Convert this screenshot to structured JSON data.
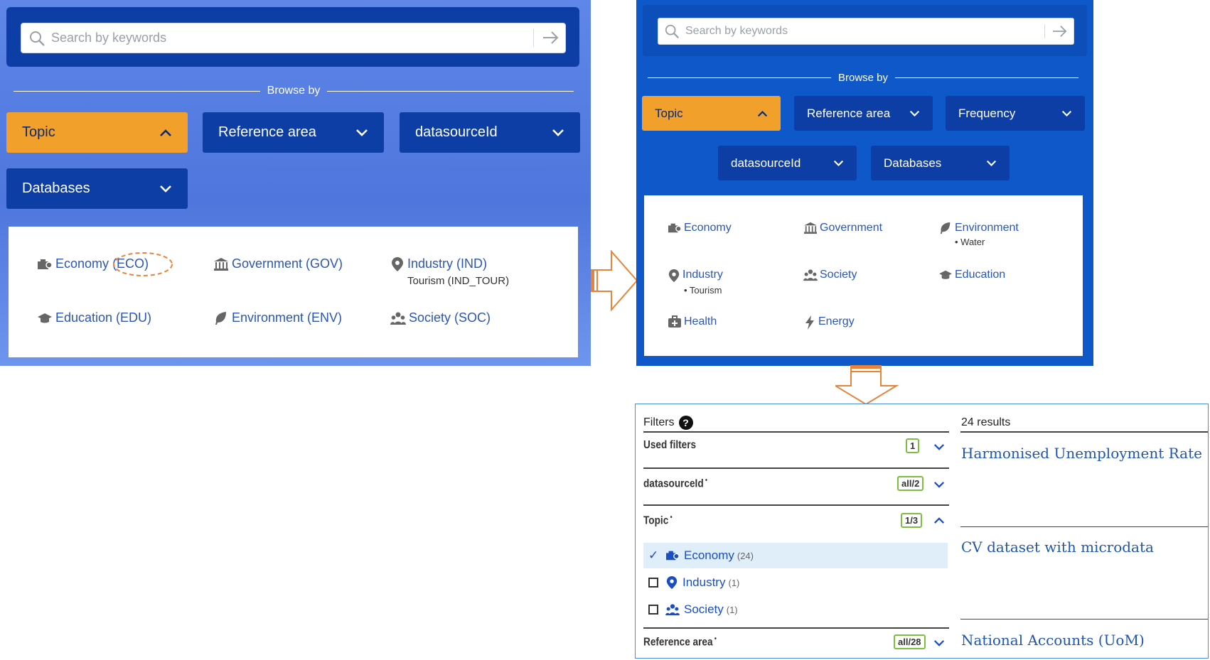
{
  "left_panel": {
    "search_placeholder": "Search by keywords",
    "browse_by": "Browse by",
    "buttons": [
      "Topic",
      "Reference area",
      "datasourceId",
      "Databases"
    ],
    "topics": [
      {
        "label": "Economy (ECO)",
        "icon": "economy-icon"
      },
      {
        "label": "Government (GOV)",
        "icon": "government-icon"
      },
      {
        "label": "Industry (IND)",
        "sub": "Tourism (IND_TOUR)",
        "icon": "location-pin-icon"
      },
      {
        "label": "Education (EDU)",
        "icon": "graduation-cap-icon"
      },
      {
        "label": "Environment (ENV)",
        "icon": "leaf-icon"
      },
      {
        "label": "Society (SOC)",
        "icon": "people-icon"
      }
    ]
  },
  "right_panel": {
    "search_placeholder": "Search by keywords",
    "browse_by": "Browse by",
    "buttons": [
      "Topic",
      "Reference area",
      "Frequency",
      "datasourceId",
      "Databases"
    ],
    "topics": [
      {
        "label": "Economy",
        "icon": "economy-icon"
      },
      {
        "label": "Government",
        "icon": "government-icon"
      },
      {
        "label": "Environment",
        "sub": "• Water",
        "icon": "leaf-icon"
      },
      {
        "label": "Industry",
        "sub": "• Tourism",
        "icon": "location-pin-icon"
      },
      {
        "label": "Society",
        "icon": "people-icon"
      },
      {
        "label": "Education",
        "icon": "graduation-cap-icon"
      },
      {
        "label": "Health",
        "icon": "medical-kit-icon"
      },
      {
        "label": "Energy",
        "icon": "lightning-icon"
      }
    ]
  },
  "filters": {
    "title": "Filters",
    "results_count": "24 results",
    "sections": [
      {
        "title": "Used filters",
        "badge": "1",
        "expanded": false
      },
      {
        "title": "datasourceId",
        "badge": "all/2",
        "expanded": false
      },
      {
        "title": "Topic",
        "badge": "1/3",
        "expanded": true
      },
      {
        "title": "Reference area",
        "badge": "all/28",
        "expanded": false
      }
    ],
    "topic_items": [
      {
        "label": "Economy",
        "count": "(24)",
        "checked": true
      },
      {
        "label": "Industry",
        "count": "(1)",
        "checked": false
      },
      {
        "label": "Society",
        "count": "(1)",
        "checked": false
      }
    ],
    "results": [
      "Harmonised Unemployment Rate",
      "CV dataset with microdata",
      "National Accounts (UoM)"
    ]
  },
  "colors": {
    "accent": "#f2a02c",
    "dark_blue": "#0c3ea6",
    "link": "#2b56b8",
    "badge": "#7cbf3e",
    "arrow": "#e8833a"
  }
}
